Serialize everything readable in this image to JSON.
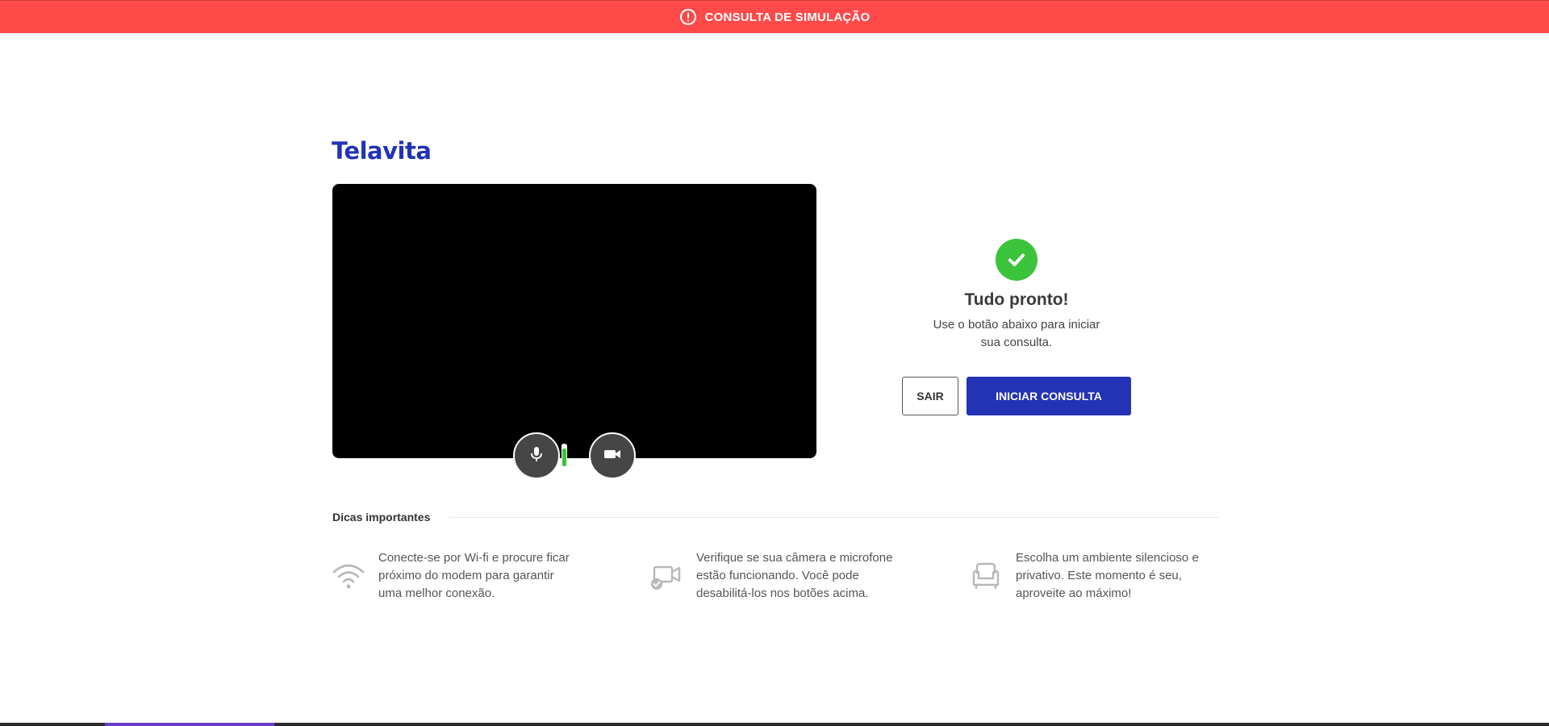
{
  "banner": {
    "text": "CONSULTA DE SIMULAÇÃO",
    "icon": "alert-circle-icon",
    "color": "#ff4a4a"
  },
  "brand": {
    "logo_text": "Telavita",
    "color": "#2233b5"
  },
  "video": {
    "controls": [
      {
        "name": "microphone",
        "icon": "microphone-icon"
      },
      {
        "name": "camera",
        "icon": "video-camera-icon"
      }
    ],
    "mic_level_indicator": "green"
  },
  "ready": {
    "icon": "check-circle-icon",
    "title": "Tudo pronto!",
    "message": "Use o botão abaixo para iniciar sua consulta."
  },
  "actions": {
    "exit_label": "SAIR",
    "start_label": "INICIAR CONSULTA"
  },
  "tips": {
    "heading": "Dicas importantes",
    "items": [
      {
        "icon": "wifi-icon",
        "text": "Conecte-se por Wi-fi e procure ficar próximo do modem para garantir uma melhor conexão."
      },
      {
        "icon": "video-check-icon",
        "text": "Verifique se sua câmera e microfone estão funcionando. Você pode desabilitá-los nos botões acima."
      },
      {
        "icon": "armchair-icon",
        "text": "Escolha um ambiente silencioso e privativo. Este momento é seu, aproveite ao máximo!"
      }
    ]
  },
  "colors": {
    "primary": "#2233b5",
    "success": "#3cc33c",
    "alert": "#ff4a4a"
  }
}
